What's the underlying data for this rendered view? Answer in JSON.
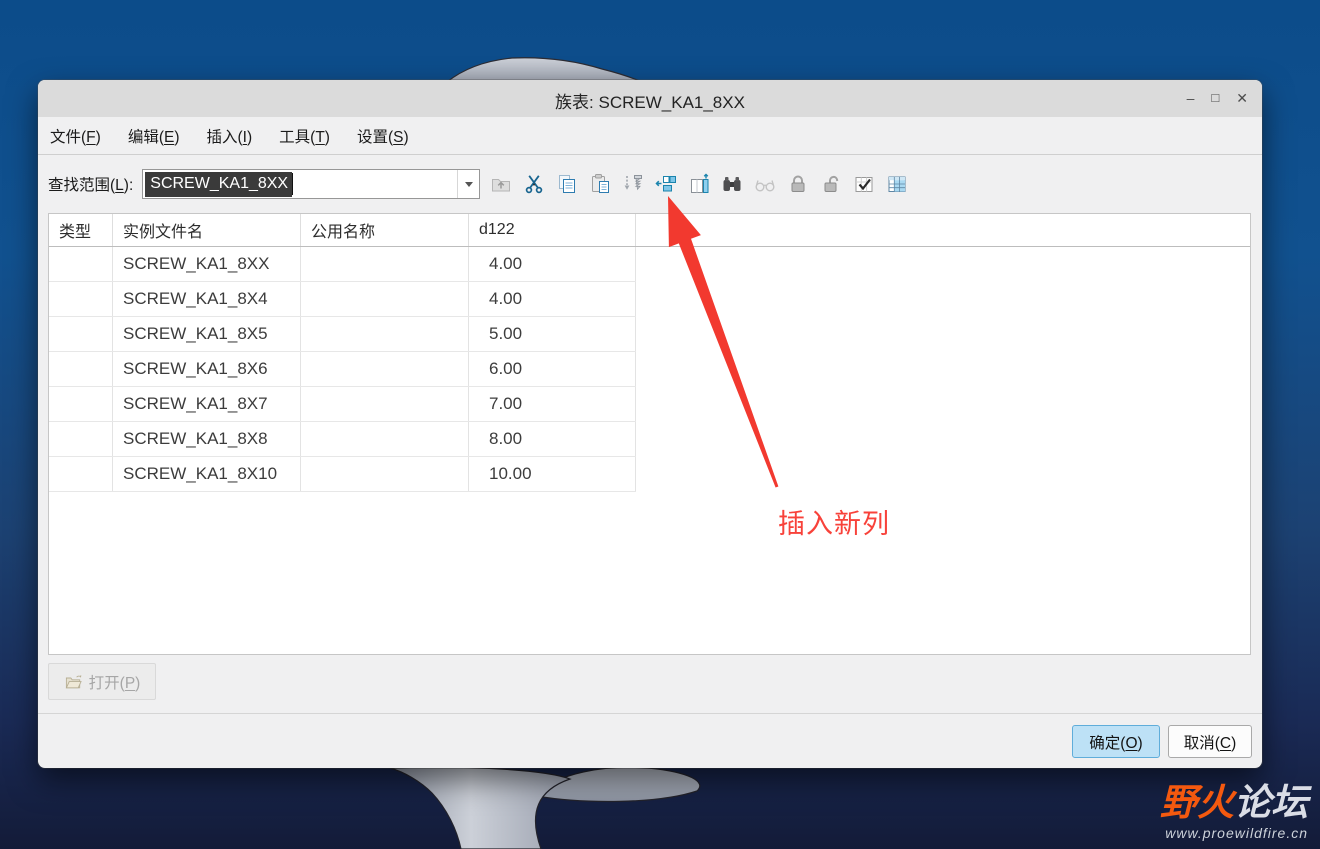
{
  "window": {
    "title": "族表: SCREW_KA1_8XX",
    "controls": {
      "minimize": "–",
      "maximize": "□",
      "close": "✕"
    }
  },
  "menu": {
    "items": [
      {
        "pre": "文件(",
        "key": "F",
        "post": ")"
      },
      {
        "pre": "编辑(",
        "key": "E",
        "post": ")"
      },
      {
        "pre": "插入(",
        "key": "I",
        "post": ")"
      },
      {
        "pre": "工具(",
        "key": "T",
        "post": ")"
      },
      {
        "pre": "设置(",
        "key": "S",
        "post": ")"
      }
    ]
  },
  "toolbar": {
    "search_label": {
      "pre": "查找范围(",
      "key": "L",
      "post": "):"
    },
    "search_value": "SCREW_KA1_8XX",
    "icons": [
      {
        "name": "folder-up-icon",
        "enabled": false
      },
      {
        "name": "cut-icon",
        "enabled": true
      },
      {
        "name": "copy-icon",
        "enabled": true
      },
      {
        "name": "paste-icon",
        "enabled": true
      },
      {
        "name": "insert-instance-icon",
        "enabled": true
      },
      {
        "name": "insert-column-icon",
        "enabled": true
      },
      {
        "name": "column-up-icon",
        "enabled": true
      },
      {
        "name": "find-icon",
        "enabled": true
      },
      {
        "name": "preview-glasses-icon",
        "enabled": false
      },
      {
        "name": "lock-icon",
        "enabled": true
      },
      {
        "name": "unlock-icon",
        "enabled": true
      },
      {
        "name": "verify-instances-icon",
        "enabled": true
      },
      {
        "name": "edit-table-icon",
        "enabled": true
      }
    ]
  },
  "table": {
    "columns": [
      "类型",
      "实例文件名",
      "公用名称",
      "d122"
    ],
    "rows": [
      {
        "type": "",
        "instance": "SCREW_KA1_8XX",
        "common": "",
        "d122": "4.00"
      },
      {
        "type": "",
        "instance": "SCREW_KA1_8X4",
        "common": "",
        "d122": "4.00"
      },
      {
        "type": "",
        "instance": "SCREW_KA1_8X5",
        "common": "",
        "d122": "5.00"
      },
      {
        "type": "",
        "instance": "SCREW_KA1_8X6",
        "common": "",
        "d122": "6.00"
      },
      {
        "type": "",
        "instance": "SCREW_KA1_8X7",
        "common": "",
        "d122": "7.00"
      },
      {
        "type": "",
        "instance": "SCREW_KA1_8X8",
        "common": "",
        "d122": "8.00"
      },
      {
        "type": "",
        "instance": "SCREW_KA1_8X10",
        "common": "",
        "d122": "10.00"
      }
    ]
  },
  "footer": {
    "open_button": {
      "pre": "打开(",
      "key": "P",
      "post": ")"
    },
    "ok_button": {
      "pre": "确定(",
      "key": "O",
      "post": ")"
    },
    "cancel_button": {
      "pre": "取消(",
      "key": "C",
      "post": ")"
    }
  },
  "annotation": {
    "label": "插入新列"
  },
  "watermark": {
    "brand_left": "野火",
    "brand_right": "论坛",
    "url": "www.proewildfire.cn"
  },
  "colors": {
    "accent_blue": "#2e7cb0",
    "ok_highlight": "#bde1f6",
    "annotation_red": "#f2392f",
    "selection_bg": "#3a3a3a",
    "watermark_orange": "#f4590f",
    "desktop_top": "#0c4c8a",
    "desktop_bottom": "#131b38"
  }
}
